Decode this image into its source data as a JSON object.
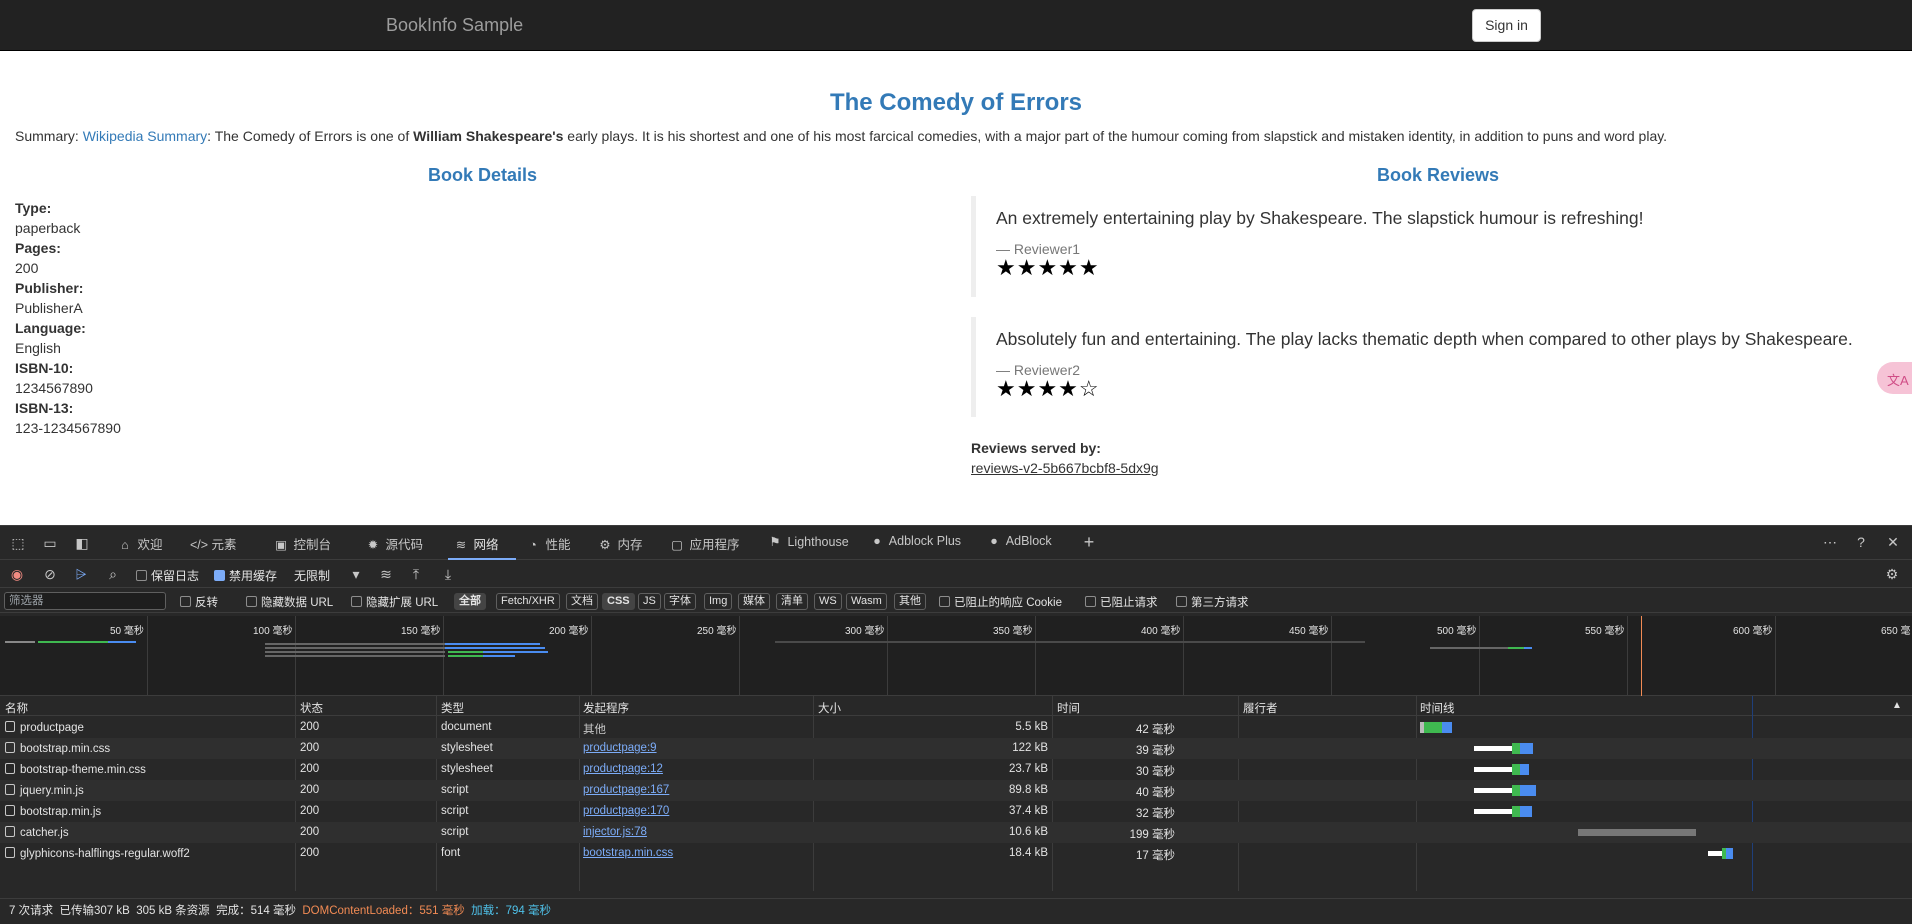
{
  "page": {
    "brand": "BookInfo Sample",
    "signin": "Sign in",
    "title": "The Comedy of Errors",
    "summary_label": "Summary: ",
    "summary_link": "Wikipedia Summary",
    "summary_text1": ": The Comedy of Errors is one of ",
    "summary_bold": "William Shakespeare's",
    "summary_text2": " early plays. It is his shortest and one of his most farcical comedies, with a major part of the humour coming from slapstick and mistaken identity, in addition to puns and word play.",
    "details_heading": "Book Details",
    "reviews_heading": "Book Reviews",
    "details": [
      {
        "label": "Type:",
        "value": "paperback"
      },
      {
        "label": "Pages:",
        "value": "200"
      },
      {
        "label": "Publisher:",
        "value": "PublisherA"
      },
      {
        "label": "Language:",
        "value": "English"
      },
      {
        "label": "ISBN-10:",
        "value": "1234567890"
      },
      {
        "label": "ISBN-13:",
        "value": "123-1234567890"
      }
    ],
    "reviews": [
      {
        "text": "An extremely entertaining play by Shakespeare. The slapstick humour is refreshing!",
        "reviewer": "— Reviewer1",
        "stars": "★★★★★",
        "rating": 5
      },
      {
        "text": "Absolutely fun and entertaining. The play lacks thematic depth when compared to other plays by Shakespeare.",
        "reviewer": "— Reviewer2",
        "stars": "★★★★☆",
        "rating": 4
      }
    ],
    "served_label": "Reviews served by:",
    "served_value": "reviews-v2-5b667bcbf8-5dx9g",
    "translate_icon": "文A"
  },
  "devtools": {
    "tabs": [
      {
        "icon": "⌂",
        "label": "欢迎"
      },
      {
        "icon": "</>",
        "label": "元素"
      },
      {
        "icon": "▣",
        "label": "控制台"
      },
      {
        "icon": "✹",
        "label": "源代码"
      },
      {
        "icon": "≋",
        "label": "网络"
      },
      {
        "icon": "◔",
        "label": "性能"
      },
      {
        "icon": "⚙",
        "label": "内存"
      },
      {
        "icon": "▢",
        "label": "应用程序"
      },
      {
        "icon": "⚑",
        "label": "Lighthouse"
      },
      {
        "icon": "●",
        "label": "Adblock Plus"
      },
      {
        "icon": "●",
        "label": "AdBlock"
      }
    ],
    "toolbar": {
      "preserve_log": "保留日志",
      "disable_cache": "禁用缓存",
      "throttle": "无限制"
    },
    "filter": {
      "placeholder": "筛选器",
      "invert": "反转",
      "hide_data_urls": "隐藏数据 URL",
      "hide_ext_urls": "隐藏扩展 URL",
      "types": [
        "全部",
        "Fetch/XHR",
        "文档",
        "CSS",
        "JS",
        "字体",
        "Img",
        "媒体",
        "清单",
        "WS",
        "Wasm",
        "其他"
      ],
      "blocked_cookies": "已阻止的响应 Cookie",
      "blocked_requests": "已阻止请求",
      "third_party": "第三方请求"
    },
    "overview_ticks": [
      "50 毫秒",
      "100 毫秒",
      "150 毫秒",
      "200 毫秒",
      "250 毫秒",
      "300 毫秒",
      "350 毫秒",
      "400 毫秒",
      "450 毫秒",
      "500 毫秒",
      "550 毫秒",
      "600 毫秒",
      "650 毫"
    ],
    "columns": [
      "名称",
      "状态",
      "类型",
      "发起程序",
      "大小",
      "时间",
      "履行者",
      "时间线"
    ],
    "requests": [
      {
        "name": "productpage",
        "status": "200",
        "type": "document",
        "initiator": "其他",
        "size": "5.5 kB",
        "time": "42 毫秒"
      },
      {
        "name": "bootstrap.min.css",
        "status": "200",
        "type": "stylesheet",
        "initiator": "productpage:9",
        "size": "122 kB",
        "time": "39 毫秒"
      },
      {
        "name": "bootstrap-theme.min.css",
        "status": "200",
        "type": "stylesheet",
        "initiator": "productpage:12",
        "size": "23.7 kB",
        "time": "30 毫秒"
      },
      {
        "name": "jquery.min.js",
        "status": "200",
        "type": "script",
        "initiator": "productpage:167",
        "size": "89.8 kB",
        "time": "40 毫秒"
      },
      {
        "name": "bootstrap.min.js",
        "status": "200",
        "type": "script",
        "initiator": "productpage:170",
        "size": "37.4 kB",
        "time": "32 毫秒"
      },
      {
        "name": "catcher.js",
        "status": "200",
        "type": "script",
        "initiator": "injector.js:78",
        "size": "10.6 kB",
        "time": "199 毫秒"
      },
      {
        "name": "glyphicons-halflings-regular.woff2",
        "status": "200",
        "type": "font",
        "initiator": "bootstrap.min.css",
        "size": "18.4 kB",
        "time": "17 毫秒"
      }
    ],
    "status_bar": {
      "requests": "7 次请求",
      "transferred": "已传输307 kB",
      "resources": "305 kB 条资源",
      "finish": "完成：514 毫秒",
      "dcl": "DOMContentLoaded：551 毫秒",
      "load": "加载：794 毫秒"
    }
  }
}
